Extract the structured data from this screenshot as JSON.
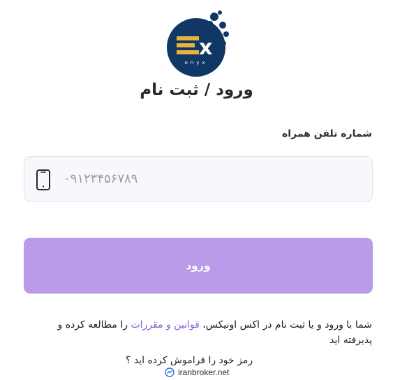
{
  "brand": {
    "logo_text": "EX",
    "logo_subtext": "onyx",
    "colors": {
      "navy": "#113864",
      "gold": "#e6b43a",
      "accent": "#ba9be9",
      "link": "#8a5fd0"
    }
  },
  "page_title": "ورود / ثبت نام",
  "phone_field": {
    "label": "شماره تلفن همراه",
    "placeholder": "۰۹۱۲۳۴۵۶۷۸۹",
    "value": "",
    "icon": "mobile-phone-icon"
  },
  "login_button": {
    "label": "ورود"
  },
  "terms": {
    "prefix": "شما با ورود و یا ثبت نام در اکس اونیکس، ",
    "link": "قوانین و مقررات",
    "suffix": " را مطالعه کرده و پذیرفته اید"
  },
  "forgot_password": "رمز خود را فراموش کرده اید ؟",
  "watermark": {
    "text": "iranbroker.net",
    "icon": "chart-check-icon"
  }
}
